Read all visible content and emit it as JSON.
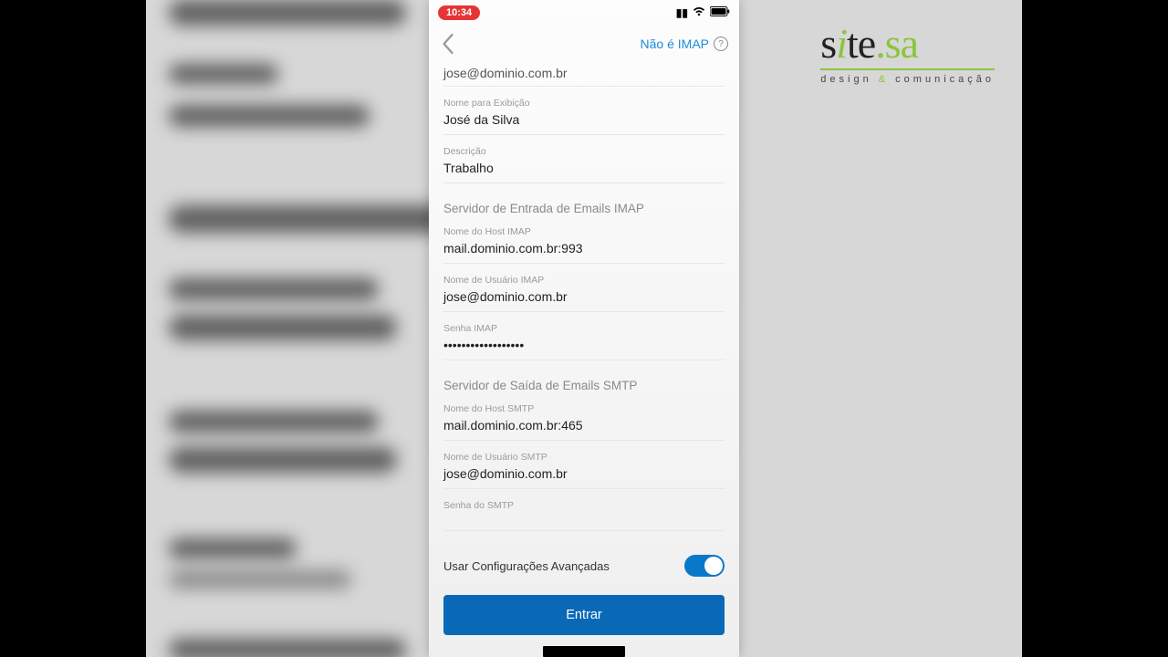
{
  "statusbar": {
    "time": "10:34"
  },
  "nav": {
    "not_imap": "Não é IMAP"
  },
  "account": {
    "email_value": "jose@dominio.com.br",
    "display_name_label": "Nome para Exibição",
    "display_name_value": "José da Silva",
    "description_label": "Descrição",
    "description_value": "Trabalho"
  },
  "imap": {
    "section": "Servidor de Entrada de Emails IMAP",
    "host_label": "Nome do Host IMAP",
    "host_value": "mail.dominio.com.br:993",
    "user_label": "Nome de Usuário IMAP",
    "user_value": "jose@dominio.com.br",
    "pass_label": "Senha IMAP",
    "pass_value": "••••••••••••••••••"
  },
  "smtp": {
    "section": "Servidor de Saída de Emails SMTP",
    "host_label": "Nome do Host SMTP",
    "host_value": "mail.dominio.com.br:465",
    "user_label": "Nome de Usuário SMTP",
    "user_value": "jose@dominio.com.br",
    "pass_label": "Senha do SMTP"
  },
  "advanced": {
    "label": "Usar Configurações Avançadas",
    "on": true
  },
  "cta": {
    "label": "Entrar"
  },
  "brand": {
    "s1": "s",
    "i": "i",
    "te": "te",
    "dot": ".",
    "sa": "sa",
    "tag_design": "design",
    "tag_amp": " & ",
    "tag_comu": "comunicação"
  }
}
